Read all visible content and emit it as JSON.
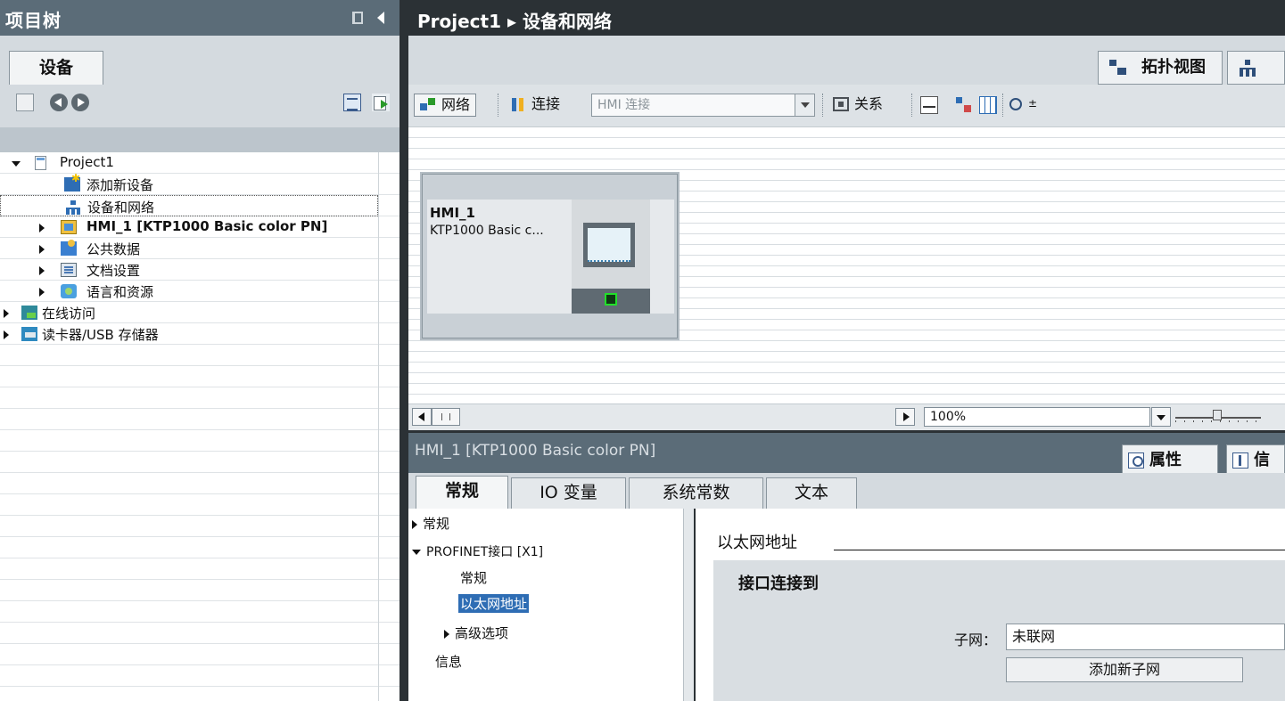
{
  "project_tree": {
    "title": "项目树",
    "tab": "设备",
    "items": [
      {
        "label": "Project1",
        "expander": "open"
      },
      {
        "label": "添加新设备",
        "expander": "none"
      },
      {
        "label": "设备和网络",
        "expander": "none"
      },
      {
        "label": "HMI_1 [KTP1000 Basic color PN]",
        "expander": "closed"
      },
      {
        "label": "公共数据",
        "expander": "closed"
      },
      {
        "label": "文档设置",
        "expander": "closed"
      },
      {
        "label": "语言和资源",
        "expander": "closed"
      },
      {
        "label": "在线访问",
        "expander": "closed"
      },
      {
        "label": "读卡器/USB 存储器",
        "expander": "closed"
      }
    ]
  },
  "editor": {
    "breadcrumb": "Project1 ▸ 设备和网络",
    "tabs": [
      "拓扑视图",
      ""
    ],
    "toolbar": {
      "network": "网络",
      "connections": "连接",
      "connection_type_placeholder": "HMI 连接",
      "relations": "关系"
    },
    "device": {
      "name": "HMI_1",
      "type": "KTP1000 Basic c..."
    },
    "zoom": "100%"
  },
  "inspector": {
    "title": "HMI_1 [KTP1000 Basic color PN]",
    "top_tabs": [
      "属性",
      "信"
    ],
    "tabs": [
      "常规",
      "IO 变量",
      "系统常数",
      "文本"
    ],
    "nav": [
      {
        "label": "常规",
        "expander": "closed"
      },
      {
        "label": "PROFINET接口 [X1]",
        "expander": "open"
      },
      {
        "label": "常规",
        "expander": "none"
      },
      {
        "label": "以太网地址",
        "expander": "none",
        "selected": true
      },
      {
        "label": "高级选项",
        "expander": "closed"
      },
      {
        "label": "信息",
        "expander": "none"
      }
    ],
    "section_title": "以太网地址",
    "box_title": "接口连接到",
    "subnet_label": "子网：",
    "subnet_value": "未联网",
    "add_subnet_button": "添加新子网"
  }
}
